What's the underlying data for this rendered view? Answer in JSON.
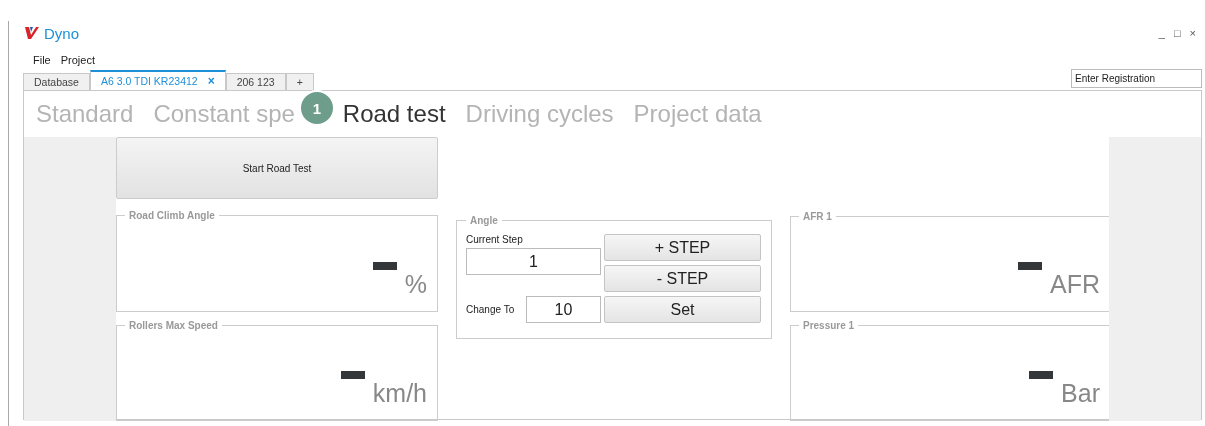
{
  "window": {
    "title": "Dyno",
    "controls": [
      "_",
      "□",
      "×"
    ]
  },
  "menu": [
    "File",
    "Project"
  ],
  "tabs": [
    {
      "label": "Database",
      "selected": false
    },
    {
      "label": "A6 3.0 TDI KR23412",
      "selected": true,
      "close": "×"
    },
    {
      "label": "206 123",
      "selected": false
    },
    {
      "label": "+",
      "selected": false
    }
  ],
  "registration": {
    "value": "Enter Registration"
  },
  "nav": [
    {
      "label": "Standard",
      "selected": false
    },
    {
      "label": "Constant spe",
      "selected": false
    },
    {
      "label": "Road test",
      "selected": true
    },
    {
      "label": "Driving cycles",
      "selected": false
    },
    {
      "label": "Project data",
      "selected": false
    }
  ],
  "badge": "1",
  "start_button": "Start Road Test",
  "left_panels": [
    {
      "title": "Road Climb Angle",
      "unit": "%"
    },
    {
      "title": "Rollers Max Speed",
      "unit": "km/h"
    }
  ],
  "angle": {
    "title": "Angle",
    "current_step_label": "Current Step",
    "current_step_value": "1",
    "change_to_label": "Change To",
    "change_to_value": "10",
    "buttons": [
      "+ STEP",
      "- STEP",
      "Set"
    ]
  },
  "right_panels": [
    {
      "title": "AFR 1",
      "unit": "AFR"
    },
    {
      "title": "Pressure 1",
      "unit": "Bar"
    }
  ]
}
